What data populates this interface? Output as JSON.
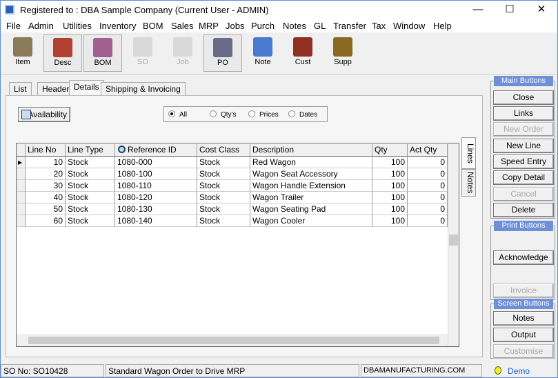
{
  "window": {
    "title": "Registered to : DBA Sample Company (Current User - ADMIN)",
    "minimize": "—",
    "maximize": "☐",
    "close": "✕"
  },
  "menu": [
    "File",
    "Admin",
    "Utilities",
    "Inventory",
    "BOM",
    "Sales",
    "MRP",
    "Jobs",
    "Purch",
    "Notes",
    "GL",
    "Transfer",
    "Tax",
    "Window",
    "Help"
  ],
  "toolbar": [
    {
      "label": "Item",
      "icon": "item-icon",
      "color": "#8a7a5a",
      "enabled": true
    },
    {
      "label": "Desc",
      "icon": "desc-icon",
      "color": "#b04030",
      "enabled": true,
      "pressed": true
    },
    {
      "label": "BOM",
      "icon": "bom-icon",
      "color": "#a06090",
      "enabled": true,
      "pressed": true
    },
    {
      "label": "SO",
      "icon": "so-icon",
      "color": "#d8d8d8",
      "enabled": false
    },
    {
      "label": "Job",
      "icon": "job-icon",
      "color": "#d8d8d8",
      "enabled": false
    },
    {
      "label": "PO",
      "icon": "po-icon",
      "color": "#6a6a8a",
      "enabled": true,
      "pressed": true
    },
    {
      "label": "Note",
      "icon": "note-icon",
      "color": "#4a7ad0",
      "enabled": true
    },
    {
      "label": "Cust",
      "icon": "cust-icon",
      "color": "#903020",
      "enabled": true
    },
    {
      "label": "Supp",
      "icon": "supp-icon",
      "color": "#8a6a20",
      "enabled": true
    }
  ],
  "tabs": [
    "List",
    "Header",
    "Details",
    "Shipping & Invoicing"
  ],
  "active_tab": "Details",
  "availability_label": "Availability",
  "view_options": {
    "options": [
      "All",
      "Qty's",
      "Prices",
      "Dates"
    ],
    "selected": "All"
  },
  "grid": {
    "columns": [
      "Line No",
      "Line Type",
      "Reference ID",
      "Cost Class",
      "Description",
      "Qty",
      "Act Qty"
    ],
    "rows": [
      [
        "10",
        "Stock",
        "1080-000",
        "Stock",
        "Red Wagon",
        "100",
        "0"
      ],
      [
        "20",
        "Stock",
        "1080-100",
        "Stock",
        "Wagon Seat Accessory",
        "100",
        "0"
      ],
      [
        "30",
        "Stock",
        "1080-110",
        "Stock",
        "Wagon Handle Extension",
        "100",
        "0"
      ],
      [
        "40",
        "Stock",
        "1080-120",
        "Stock",
        "Wagon Trailer",
        "100",
        "0"
      ],
      [
        "50",
        "Stock",
        "1080-130",
        "Stock",
        "Wagon Seating Pad",
        "100",
        "0"
      ],
      [
        "60",
        "Stock",
        "1080-140",
        "Stock",
        "Wagon Cooler",
        "100",
        "0"
      ]
    ]
  },
  "side_tabs": [
    "Lines",
    "Notes"
  ],
  "main_buttons": {
    "title": "Main Buttons",
    "items": [
      {
        "label": "Close",
        "enabled": true,
        "icon": ""
      },
      {
        "label": "Links",
        "enabled": true,
        "icon": "links-icon"
      },
      {
        "label": "New Order",
        "enabled": false,
        "icon": "new-order-icon"
      },
      {
        "label": "New Line",
        "enabled": true,
        "icon": "pencil-icon"
      },
      {
        "label": "Speed Entry",
        "enabled": true,
        "icon": "stopwatch-icon"
      },
      {
        "label": "Copy Detail",
        "enabled": true,
        "icon": "copy-icon"
      },
      {
        "label": "Cancel",
        "enabled": false,
        "icon": ""
      },
      {
        "label": "Delete",
        "enabled": true,
        "icon": "x-icon"
      }
    ]
  },
  "print_buttons": {
    "title": "Print Buttons",
    "items": [
      {
        "label": "Acknowledge",
        "enabled": true
      },
      {
        "label": "Invoice",
        "enabled": false
      }
    ]
  },
  "screen_buttons": {
    "title": "Screen Buttons",
    "items": [
      {
        "label": "Notes",
        "enabled": true
      },
      {
        "label": "Output",
        "enabled": true
      },
      {
        "label": "Customise",
        "enabled": false
      }
    ]
  },
  "status": {
    "so_no": "SO No: SO10428",
    "description": "Standard Wagon Order to Drive MRP",
    "website": "DBAMANUFACTURING.COM",
    "demo": "Demo"
  }
}
